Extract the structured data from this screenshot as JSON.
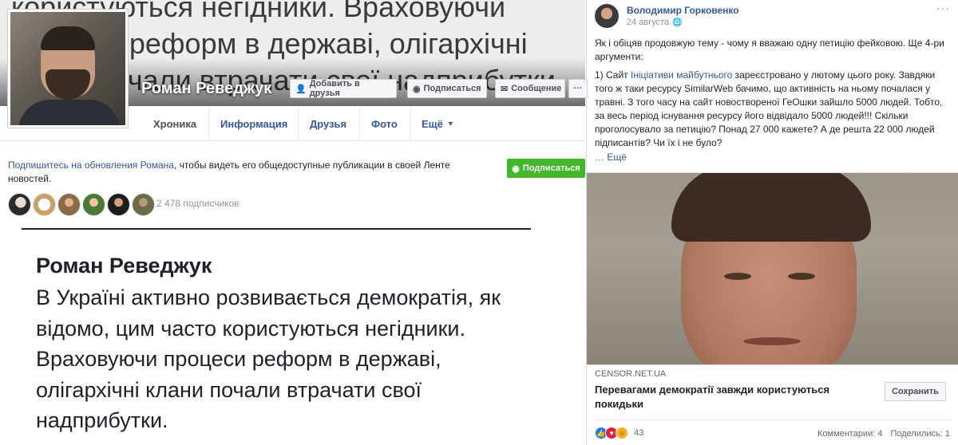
{
  "profile": {
    "name": "Роман Реведжук",
    "cover_text": "користуються негідники. Враховуючи процеси реформ в державі, олігархічні клани почали втрачати свої надприбутки.",
    "buttons": {
      "add_friend": "Добавить в друзья",
      "follow": "Подписаться",
      "message": "Сообщение",
      "more": "···"
    },
    "tabs": [
      "Хроника",
      "Информация",
      "Друзья",
      "Фото",
      "Ещё"
    ],
    "follow_prompt": {
      "link": "Подпишитесь на обновления Романа",
      "text": ", чтобы видеть его общедоступные публикации в своей Ленте новостей."
    },
    "follow_button": "Подписаться",
    "subscribers": "2 478 подписчиков"
  },
  "quote_post": {
    "author": "Роман Реведжук",
    "body": "В Україні активно розвивається демократія, як відомо, цим часто користуються негідники. Враховуючи процеси реформ в державі, олігархічні клани почали втрачати свої надприбутки."
  },
  "shared_post": {
    "author": "Володимир Горковенко",
    "date": "24 августа",
    "paragraph1": "Як і обіцяв продовжую тему - чому я вважаю одну петицію фейковою. Ще 4-ри аргументи:",
    "paragraph2_prefix": "1) Сайт ",
    "paragraph2_link": "Ініціативи майбутнього",
    "paragraph2_rest": " зареєстровано у лютому цього року. Завдяки того ж таки ресурсу SimilarWeb бачимо, що активність на ньому почалася у травні. З того часу на сайт новоствореної ГеОшки зайшло 5000 людей. Тобто, за весь період існування ресурсу його відвідало 5000 людей!!! Скільки проголосувало за петицію? Понад 27 000 кажете? А де решта 22 000 людей підписантів? Чи їх і не було?",
    "see_more": "… Ещё",
    "link_source": "CENSOR.NET.UA",
    "link_title": "Перевагами демократії завжди користуються покидьки",
    "save_button": "Сохранить",
    "reaction_count": "43",
    "comments": "Комментарии: 4",
    "shares": "Поделились: 1"
  },
  "colors": {
    "link": "#365899",
    "green_button": "#42b72a",
    "text": "#1d2129",
    "muted": "#90949c"
  }
}
